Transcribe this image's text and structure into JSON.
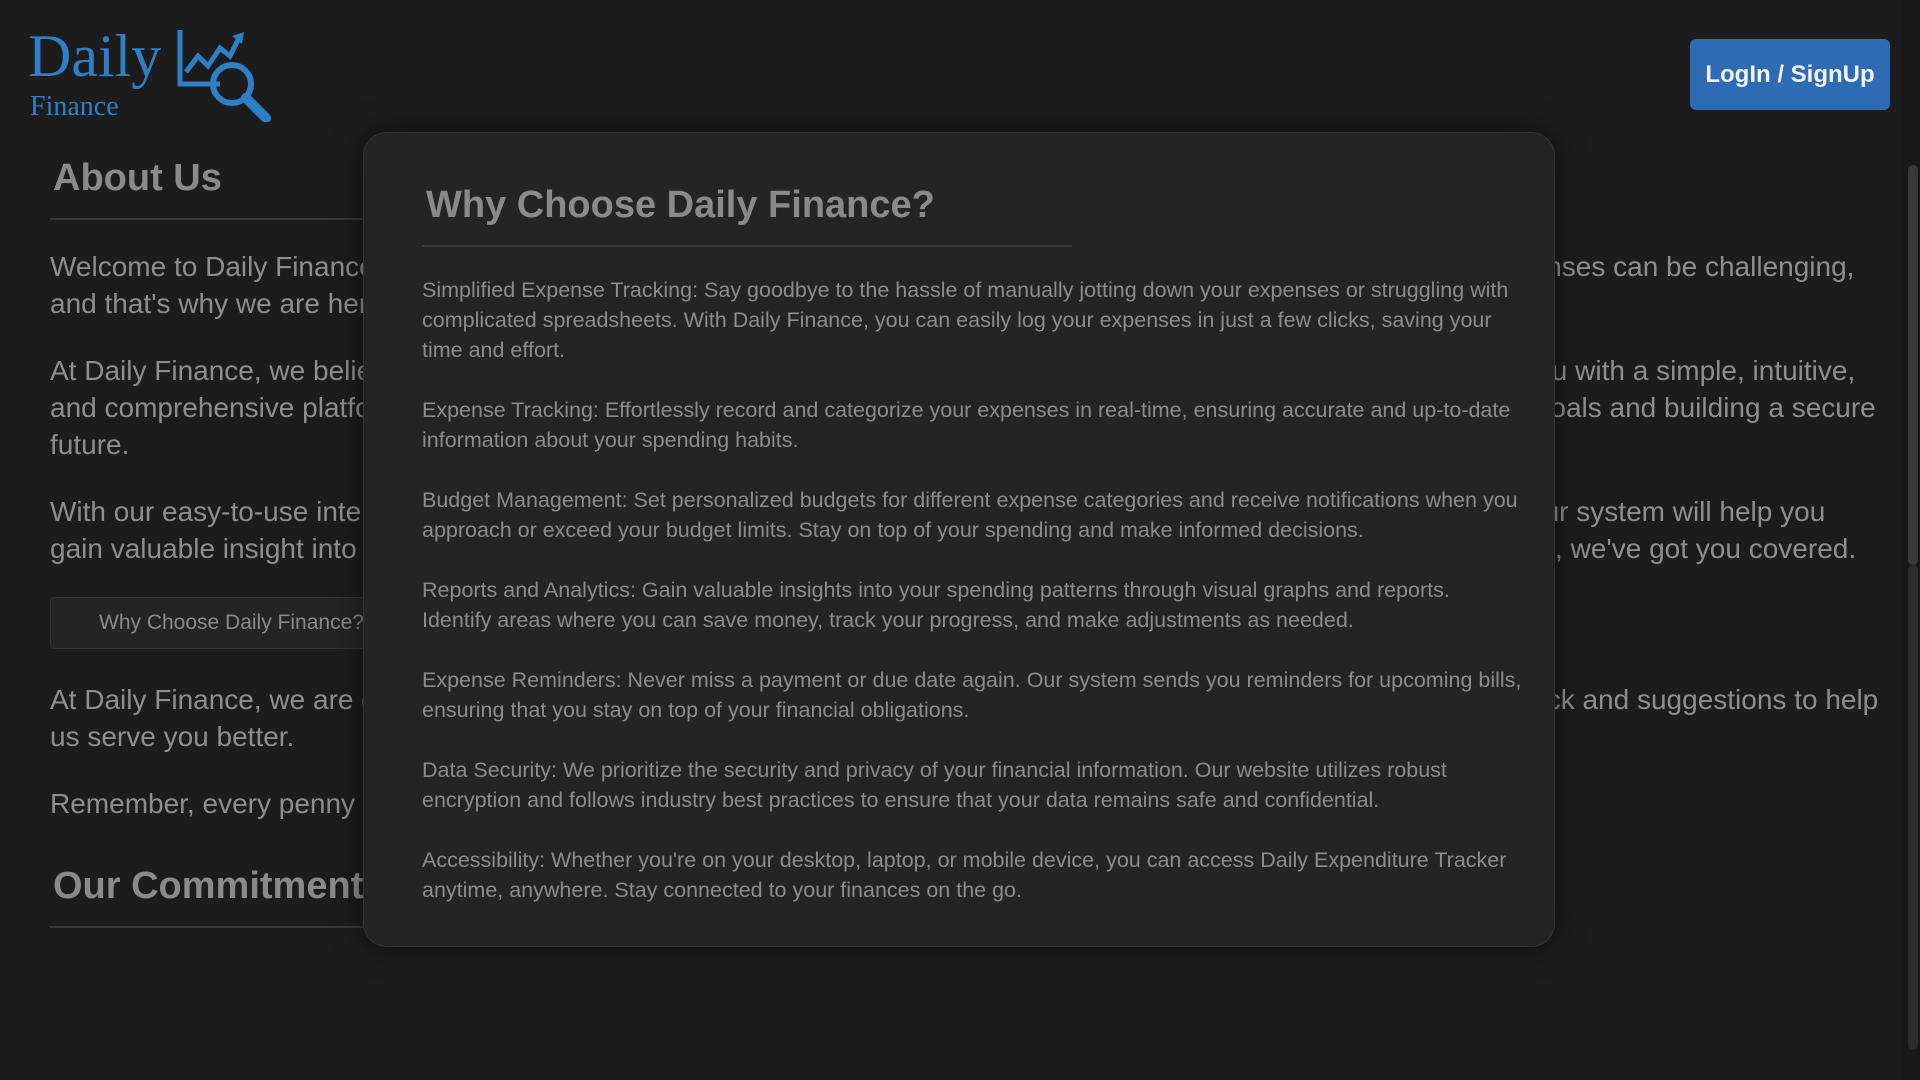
{
  "header": {
    "logo_word1": "Daily",
    "logo_word2": "Finance",
    "login_label": "LogIn / SignUp"
  },
  "colors": {
    "accent": "#2f7fc8",
    "button": "#2f6bb5",
    "background": "#1c1c1c",
    "modal": "#242424"
  },
  "about": {
    "title": "About Us",
    "p1": "Welcome to Daily Finance, your go-to solution for tracking your daily expenses! We understand that managing daily expenses can be challenging, and that's why we are here to empower you to take control of your finances effortlessly.",
    "p2": "At Daily Finance, we believe that financial well-being is key to a fulfilling life. Our mission is to empower individuals like you with a simple, intuitive, and comprehensive platform to track and analyze your daily expenses, helping you make informed decisions, achieving goals and building a secure future.",
    "p3": "With our easy-to-use interface, you can quickly enter your expenses, select the category, and add any relevant details. Our system will help you gain valuable insight into where your money is going. Whether you want to track your daily expenses or plan for the future, we've got you covered.",
    "why_button": "Why Choose Daily Finance?",
    "p4": "At Daily Finance, we are continuously working to improve our platform to meet the evolving needs. We value your feedback and suggestions to help us serve you better.",
    "p5": "Remember, every penny counts, and with Daily Finance, you can make every penny count."
  },
  "commitment": {
    "title": "Our Commitment to You"
  },
  "modal": {
    "title": "Why Choose Daily Finance?",
    "items": [
      "Simplified Expense Tracking: Say goodbye to the hassle of manually jotting down your expenses or struggling with complicated spreadsheets. With Daily Finance, you can easily log your expenses in just a few clicks, saving your time and effort.",
      "Expense Tracking: Effortlessly record and categorize your expenses in real-time, ensuring accurate and up-to-date information about your spending habits.",
      "Budget Management: Set personalized budgets for different expense categories and receive notifications when you approach or exceed your budget limits. Stay on top of your spending and make informed decisions.",
      "Reports and Analytics: Gain valuable insights into your spending patterns through visual graphs and reports. Identify areas where you can save money, track your progress, and make adjustments as needed.",
      "Expense Reminders: Never miss a payment or due date again. Our system sends you reminders for upcoming bills, ensuring that you stay on top of your financial obligations.",
      "Data Security: We prioritize the security and privacy of your financial information. Our website utilizes robust encryption and follows industry best practices to ensure that your data remains safe and confidential.",
      "Accessibility: Whether you're on your desktop, laptop, or mobile device, you can access Daily Expenditure Tracker anytime, anywhere. Stay connected to your finances on the go."
    ]
  }
}
